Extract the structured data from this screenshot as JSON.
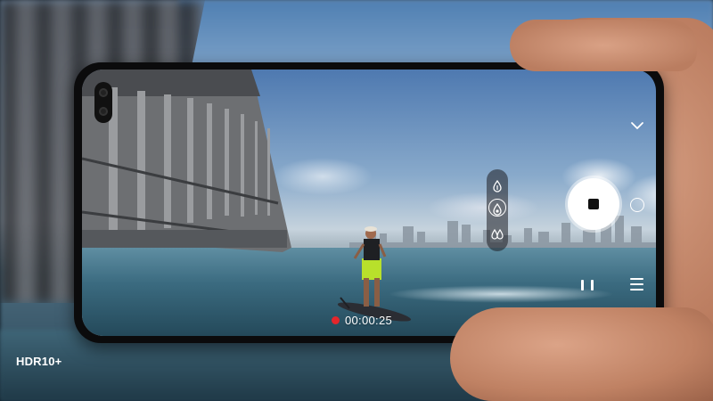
{
  "overlay": {
    "badge": "HDR10+"
  },
  "camera": {
    "recording_time": "00:00:25",
    "recording_indicator_color": "#e5262b",
    "mode_icons": [
      "flame-drop-icon",
      "focus-drop-icon",
      "multi-drop-icon"
    ],
    "controls": [
      "record-stop-button",
      "snapshot-button",
      "pause-button",
      "menu-button",
      "collapse-chevron-icon"
    ]
  },
  "colors": {
    "record_button": "#ffffff",
    "stop_square": "#111111",
    "phone_body": "#0b0b0c"
  }
}
